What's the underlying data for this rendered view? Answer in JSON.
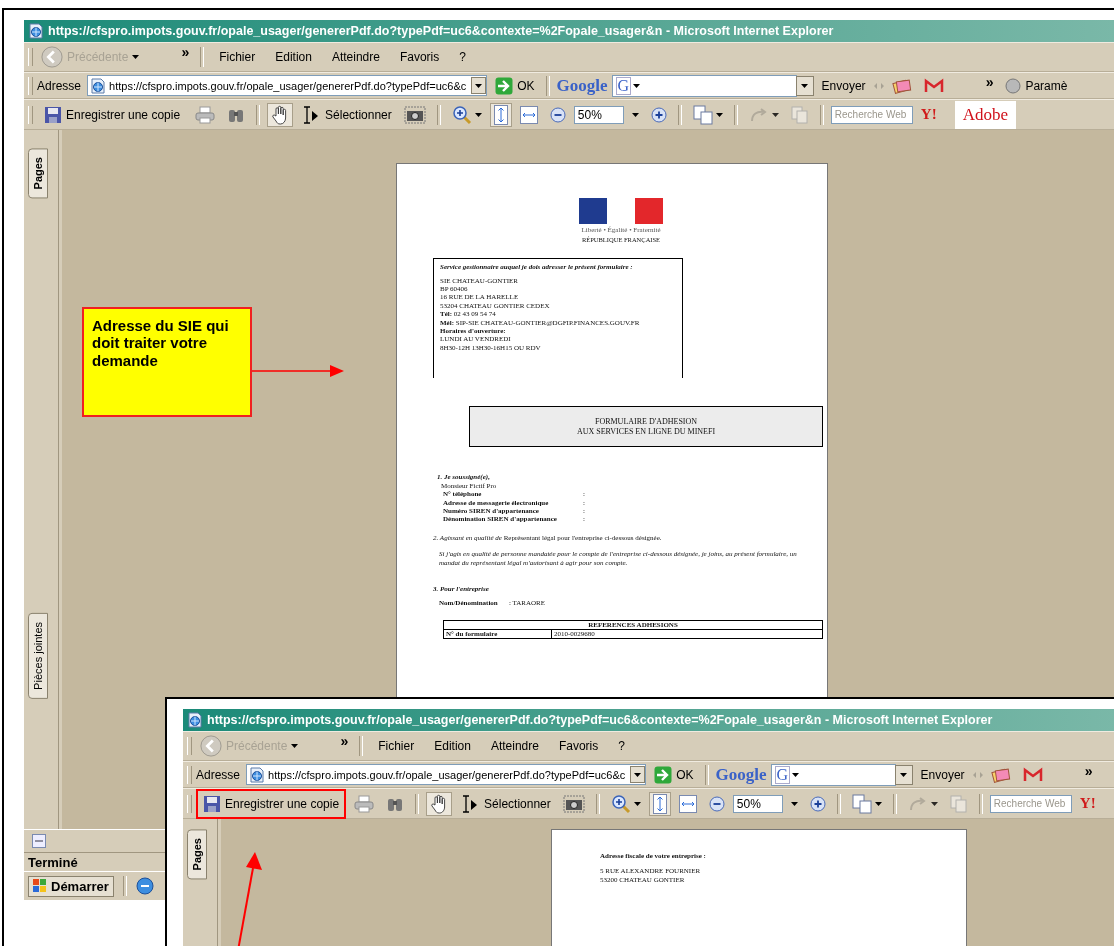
{
  "windows": [
    {
      "title": "https://cfspro.impots.gouv.fr/opale_usager/genererPdf.do?typePdf=uc6&contexte=%2Fopale_usager&n - Microsoft Internet Explorer",
      "back": {
        "label": "Précédente",
        "disabled": true
      },
      "overflow": "»",
      "menu": [
        "Fichier",
        "Edition",
        "Atteindre",
        "Favoris",
        "?"
      ],
      "address": {
        "label": "Adresse",
        "value": "https://cfspro.impots.gouv.fr/opale_usager/genererPdf.do?typePdf=uc6&c",
        "go": "OK"
      },
      "google": {
        "logo": "Google",
        "g": "G",
        "send": "Envoyer",
        "overflow": "»",
        "settings": "Paramè"
      },
      "toolbar": {
        "save": "Enregistrer une copie",
        "save_highlighted": false,
        "hand_selected": true,
        "fit_page_selected": true,
        "select": "Sélectionner",
        "zoom": "50%",
        "search_placeholder": "Recherche Web",
        "yahoo": "Y!",
        "adobe": "Adobe"
      },
      "side_tabs": [
        "Pages",
        "Pièces jointes"
      ],
      "document": {
        "kind": "form",
        "motto": "Liberté • Égalité • Fraternité",
        "republic": "RÉPUBLIQUE FRANÇAISE",
        "service": {
          "heading": "Service gestionnaire auquel je dois adresser le présent formulaire :",
          "lines": [
            {
              "text": "SIE  CHATEAU-GONTIER",
              "bold": false
            },
            {
              "text": "BP 60406",
              "bold": false
            },
            {
              "text": "16 RUE DE LA HARELLE",
              "bold": false
            },
            {
              "text": "53204 CHATEAU GONTIER CEDEX",
              "bold": false
            },
            {
              "text": "**Tél:** 02 43 09 54 74",
              "bold": false
            },
            {
              "text": "**Mél:** SIP-SIE CHATEAU-GONTIER@DGFIP.FINANCES.GOUV.FR",
              "bold": false
            },
            {
              "text": "Horaires d'ouverture:",
              "bold": true
            },
            {
              "text": "LUNDI AU VENDREDI",
              "bold": false
            },
            {
              "text": "8H30-12H 13H30-16H15 OU RDV",
              "bold": false
            }
          ]
        },
        "title": [
          "FORMULAIRE D'ADHESION",
          "AUX SERVICES EN LIGNE DU MINEFI"
        ],
        "s1": {
          "heading": "1. Je soussigné(e),",
          "name": "Monsieur  Fictif  Pro",
          "fields": [
            {
              "label": "N° téléphone",
              "value": ":"
            },
            {
              "label": "Adresse de messagerie électronique",
              "value": ":"
            },
            {
              "label": "Numéro SIREN d'appartenance",
              "value": ":"
            },
            {
              "label": "Dénomination SIREN d'appartenance",
              "value": ":"
            }
          ]
        },
        "s2": {
          "text": "*2. Agissant en qualité de*  Représentant légal  pour l'entreprise ci-dessous désignée.",
          "note": "Si j'agis en qualité de personne mandatée pour le compte de l'entreprise ci-dessous désignée, je joins, au présent formulaire, un mandat du représentant légal m'autorisant à agir pour son compte."
        },
        "s3": {
          "heading": "3. Pour l'entreprise",
          "label": "Nom/Dénomination",
          "value": ": TARAORE"
        },
        "table": {
          "heading": "REFERENCES ADHESIONS",
          "rows": [
            [
              "N° du formulaire",
              "2010-0029680"
            ]
          ]
        }
      },
      "status": "Terminé",
      "start": "Démarrer"
    },
    {
      "title": "https://cfspro.impots.gouv.fr/opale_usager/genererPdf.do?typePdf=uc6&contexte=%2Fopale_usager&n - Microsoft Internet Explorer",
      "back": {
        "label": "Précédente",
        "disabled": true
      },
      "overflow": "»",
      "menu": [
        "Fichier",
        "Edition",
        "Atteindre",
        "Favoris",
        "?"
      ],
      "address": {
        "label": "Adresse",
        "value": "https://cfspro.impots.gouv.fr/opale_usager/genererPdf.do?typePdf=uc6&c",
        "go": "OK"
      },
      "google": {
        "logo": "Google",
        "g": "G",
        "send": "Envoyer",
        "overflow": "»"
      },
      "toolbar": {
        "save": "Enregistrer une copie",
        "save_highlighted": true,
        "hand_selected": true,
        "fit_page_selected": true,
        "select": "Sélectionner",
        "zoom": "50%",
        "search_placeholder": "Recherche Web",
        "yahoo": "Y!"
      },
      "side_tabs": [
        "Pages"
      ],
      "document": {
        "kind": "address",
        "heading": "Adresse fiscale de votre entreprise :",
        "lines": [
          "5  RUE  ALEXANDRE FOURNIER",
          "53200  CHATEAU GONTIER"
        ]
      }
    }
  ],
  "callout": {
    "text": "Adresse du SIE qui doit traiter votre demande"
  }
}
